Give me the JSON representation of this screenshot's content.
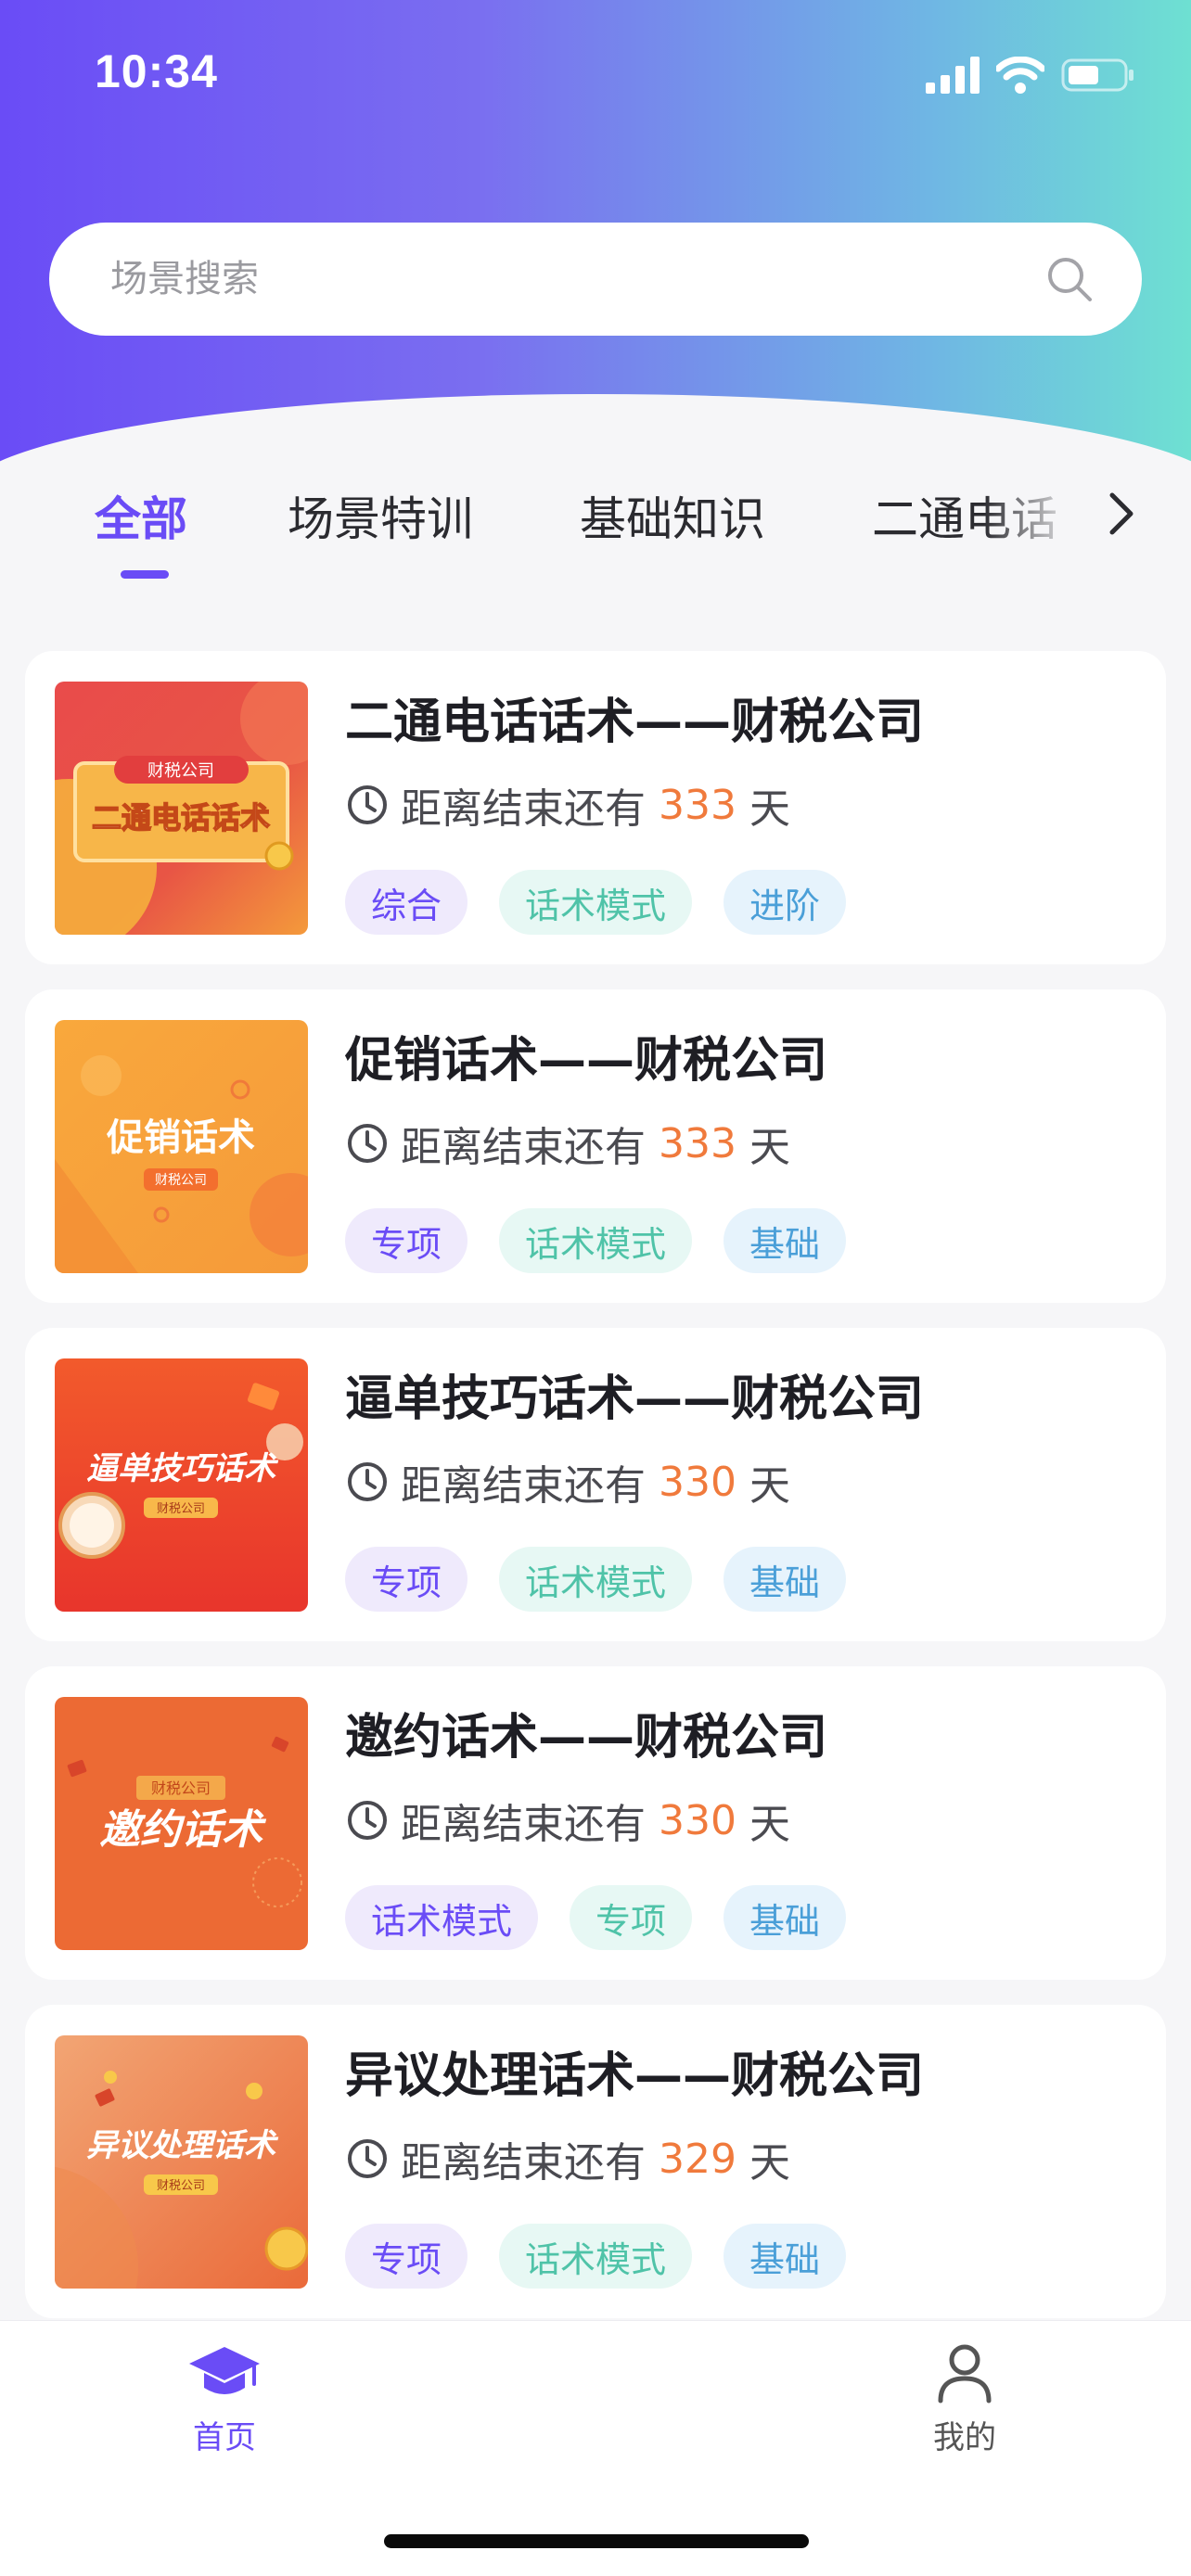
{
  "status_bar": {
    "time": "10:34"
  },
  "search": {
    "placeholder": "场景搜索"
  },
  "tabs": [
    {
      "label": "全部",
      "active": true
    },
    {
      "label": "场景特训",
      "active": false
    },
    {
      "label": "基础知识",
      "active": false
    },
    {
      "label": "二通电话",
      "active": false
    }
  ],
  "countdown_prefix": "距离结束还有",
  "countdown_suffix": "天",
  "cards": [
    {
      "title": "二通电话话术——财税公司",
      "days": "333",
      "thumb_caption": "财税公司",
      "thumb_text": "二通电话话术",
      "tags": [
        {
          "label": "综合",
          "color": "purple"
        },
        {
          "label": "话术模式",
          "color": "green"
        },
        {
          "label": "进阶",
          "color": "blue"
        }
      ]
    },
    {
      "title": "促销话术——财税公司",
      "days": "333",
      "thumb_caption": "财税公司",
      "thumb_text": "促销话术",
      "tags": [
        {
          "label": "专项",
          "color": "purple"
        },
        {
          "label": "话术模式",
          "color": "green"
        },
        {
          "label": "基础",
          "color": "blue"
        }
      ]
    },
    {
      "title": "逼单技巧话术——财税公司",
      "days": "330",
      "thumb_caption": "财税公司",
      "thumb_text": "逼单技巧话术",
      "tags": [
        {
          "label": "专项",
          "color": "purple"
        },
        {
          "label": "话术模式",
          "color": "green"
        },
        {
          "label": "基础",
          "color": "blue"
        }
      ]
    },
    {
      "title": "邀约话术——财税公司",
      "days": "330",
      "thumb_caption": "财税公司",
      "thumb_text": "邀约话术",
      "tags": [
        {
          "label": "话术模式",
          "color": "purple"
        },
        {
          "label": "专项",
          "color": "green"
        },
        {
          "label": "基础",
          "color": "blue"
        }
      ]
    },
    {
      "title": "异议处理话术——财税公司",
      "days": "329",
      "thumb_caption": "财税公司",
      "thumb_text": "异议处理话术",
      "tags": [
        {
          "label": "专项",
          "color": "purple"
        },
        {
          "label": "话术模式",
          "color": "green"
        },
        {
          "label": "基础",
          "color": "blue"
        }
      ]
    }
  ],
  "bottom_nav": [
    {
      "label": "首页",
      "icon": "graduation-cap-icon",
      "active": true
    },
    {
      "label": "我的",
      "icon": "user-icon",
      "active": false
    }
  ],
  "colors": {
    "accent": "#6a4cf6",
    "gradient_end": "#6ee0d2",
    "days_highlight": "#f07a3c"
  }
}
